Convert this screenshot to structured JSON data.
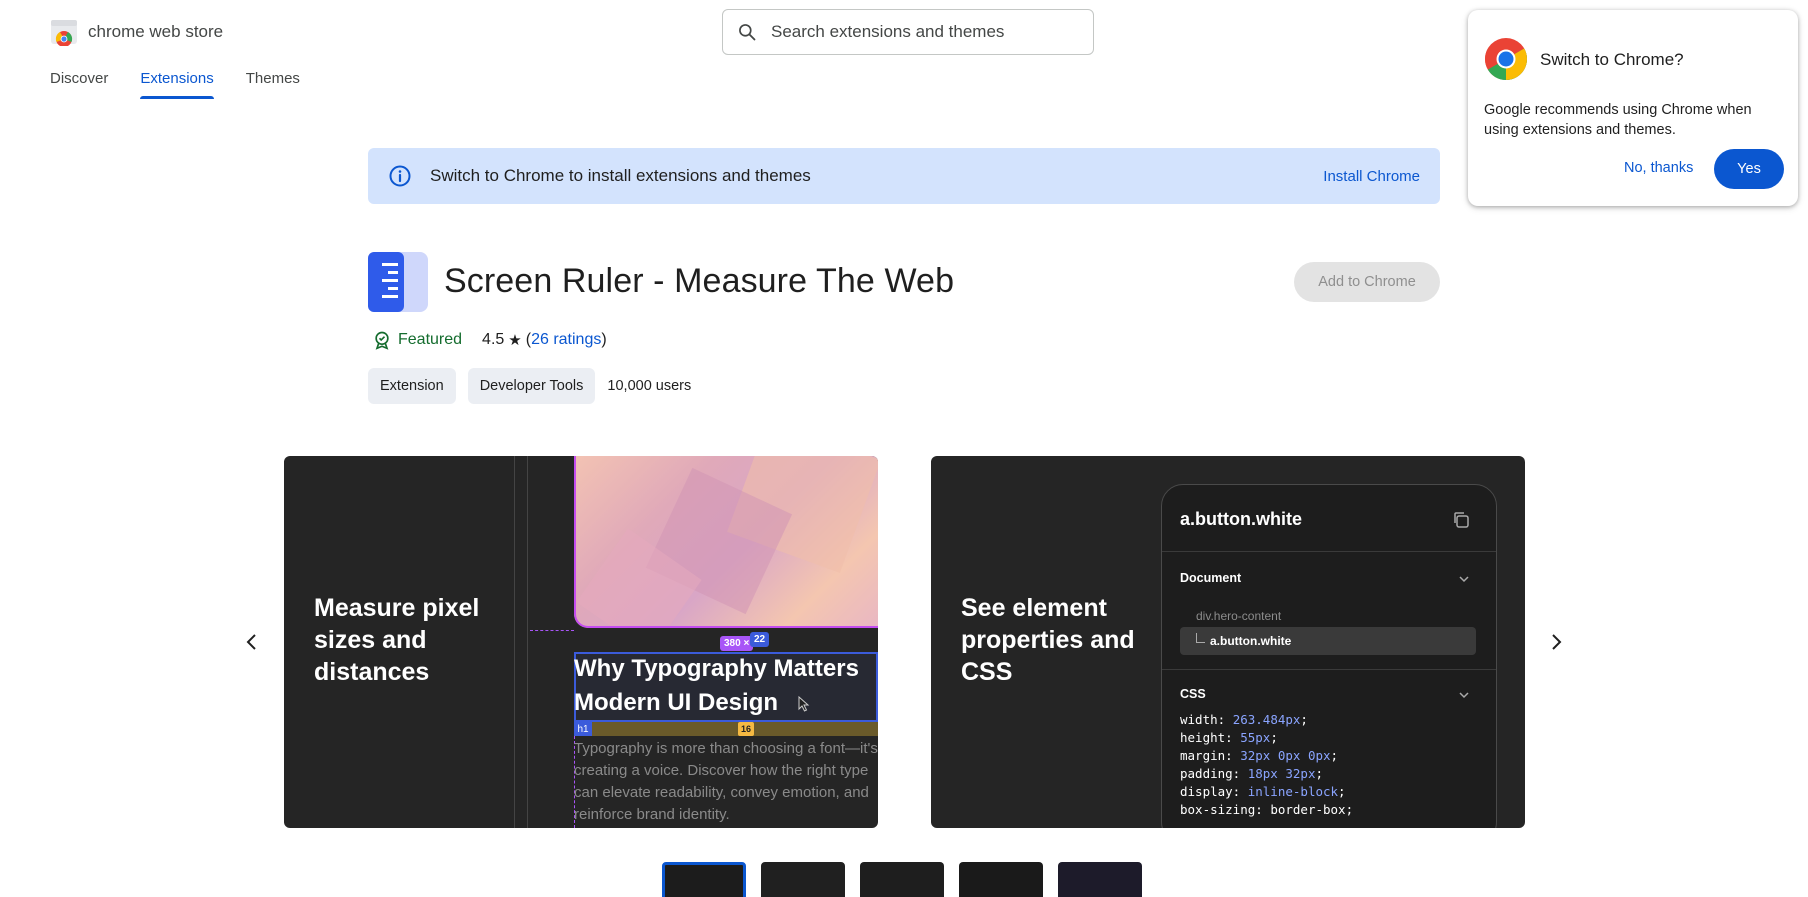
{
  "header": {
    "logo_text": "chrome web store",
    "search_placeholder": "Search extensions and themes",
    "nav": [
      {
        "label": "Discover",
        "active": false
      },
      {
        "label": "Extensions",
        "active": true
      },
      {
        "label": "Themes",
        "active": false
      }
    ]
  },
  "banner": {
    "text": "Switch to Chrome to install extensions and themes",
    "link": "Install Chrome"
  },
  "popup": {
    "title": "Switch to Chrome?",
    "body": "Google recommends using Chrome when using extensions and themes.",
    "no_label": "No, thanks",
    "yes_label": "Yes"
  },
  "extension": {
    "title": "Screen Ruler - Measure The Web",
    "add_label": "Add to Chrome",
    "featured_label": "Featured",
    "rating": "4.5",
    "star": "★",
    "ratings_open": "(",
    "ratings_link": "26 ratings",
    "ratings_close": ")",
    "chips": [
      "Extension",
      "Developer Tools"
    ],
    "users": "10,000 users"
  },
  "carousel": {
    "slides": [
      {
        "caption": [
          "Measure pixel",
          "sizes and",
          "distances"
        ],
        "badge_width": "380 ×",
        "badge_height": "22",
        "heading": [
          "Why Typography Matters",
          "Modern UI Design"
        ],
        "tag": "h1",
        "spacer": "16",
        "body": [
          "Typography is more than choosing a font—it's",
          "creating a voice. Discover how the right type",
          "can elevate readability, convey emotion, and",
          "reinforce brand identity."
        ]
      },
      {
        "caption": [
          "See element",
          "properties and",
          "CSS"
        ],
        "panel_title": "a.button.white",
        "section_document": "Document",
        "path_parent": "div.hero-content",
        "path_selected": "a.button.white",
        "section_css": "CSS",
        "css": [
          {
            "prop": "width",
            "value": "263.484px",
            "highlight": true
          },
          {
            "prop": "height",
            "value": "55px",
            "highlight": true
          },
          {
            "prop": "margin",
            "value": "32px 0px 0px",
            "highlight": true
          },
          {
            "prop": "padding",
            "value": "18px 32px",
            "highlight": true
          },
          {
            "prop": "display",
            "value": "inline-block",
            "highlight": true
          },
          {
            "prop": "box-sizing",
            "value": "border-box",
            "highlight": false
          }
        ]
      }
    ],
    "thumbnail_count": 5
  },
  "colors": {
    "accent": "#0b57d0",
    "banner_bg": "#d3e3fd",
    "featured_green": "#146c2e",
    "slide_bg": "#252525"
  }
}
